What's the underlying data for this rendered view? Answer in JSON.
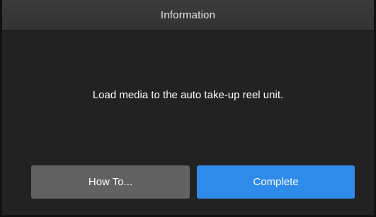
{
  "dialog": {
    "title": "Information",
    "message": "Load media to the auto take-up reel unit.",
    "buttons": {
      "howto_label": "How To...",
      "complete_label": "Complete"
    }
  },
  "colors": {
    "background": "#222222",
    "title_bar": "#363636",
    "howto_button": "#616161",
    "complete_button": "#2f8bea",
    "text": "#ffffff"
  }
}
